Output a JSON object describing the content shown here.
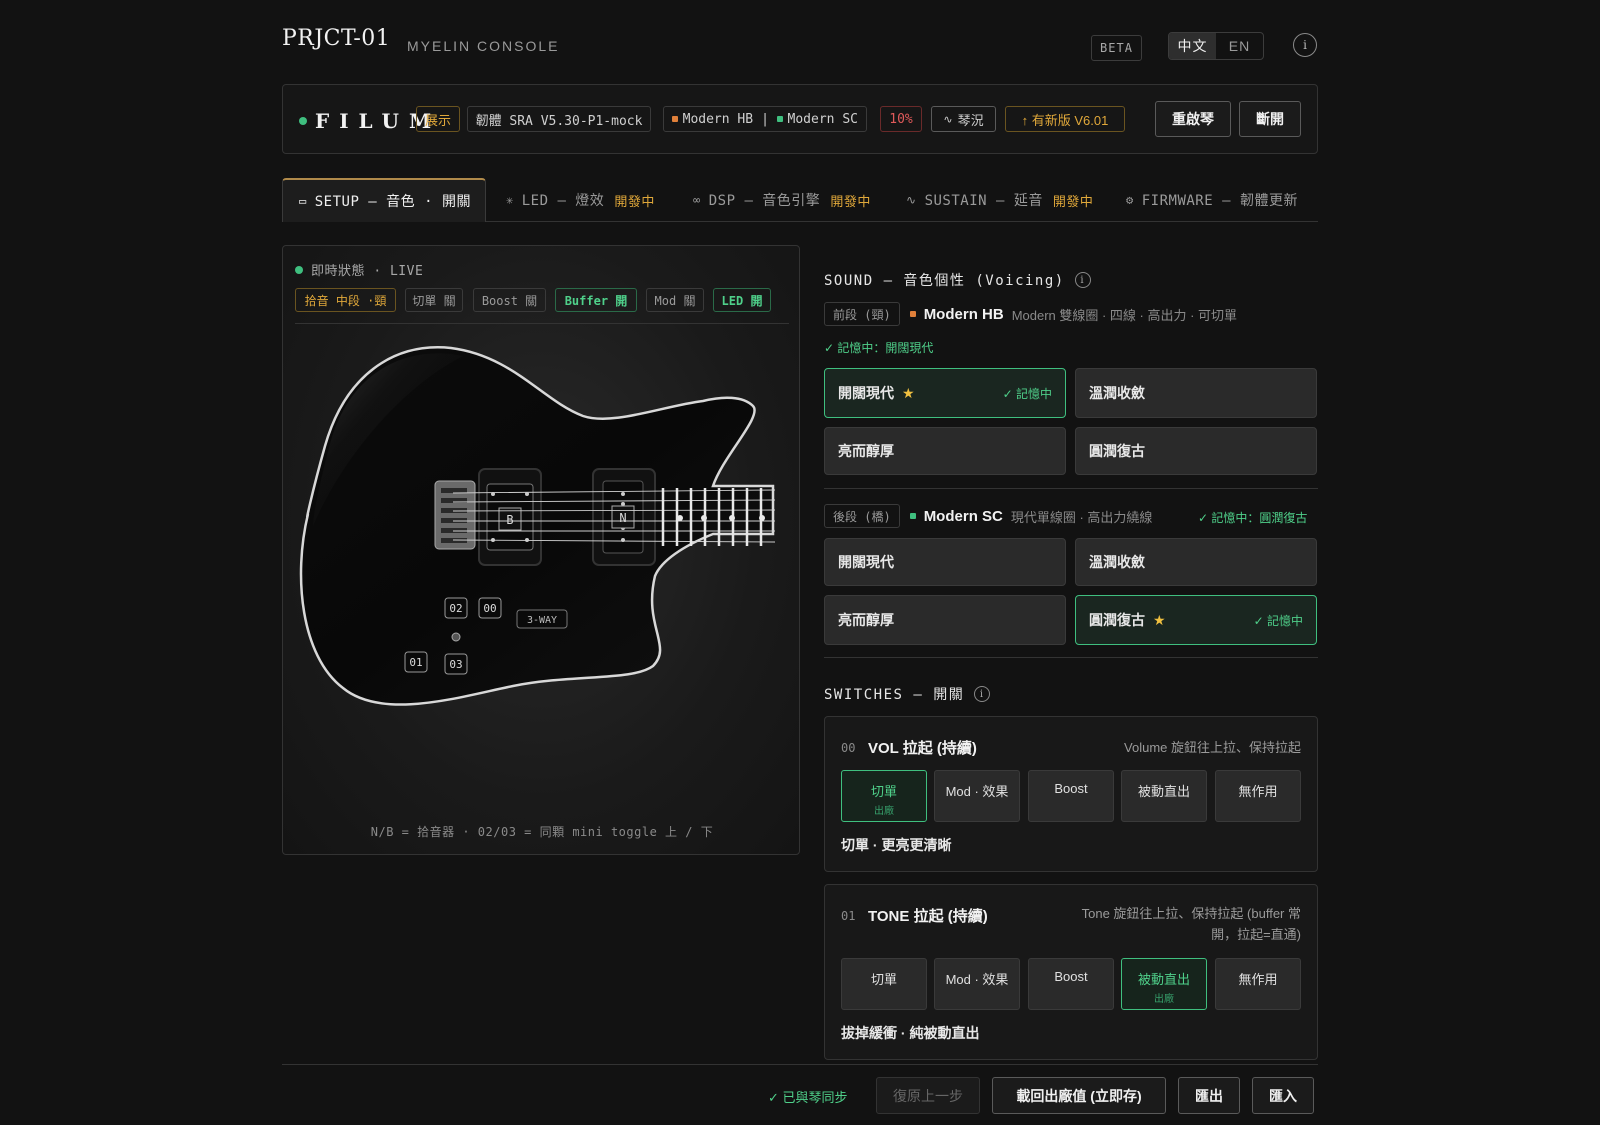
{
  "header": {
    "brand": "PRJCT-01",
    "subtitle": "MYELIN CONSOLE",
    "beta": "BETA",
    "lang_zh": "中文",
    "lang_en": "EN",
    "info": "i"
  },
  "device": {
    "name": "FILUM",
    "mode": "展示",
    "firmware": "韌體 SRA V5.30-P1-mock",
    "pickup_front": "Modern HB",
    "pickup_sep": "|",
    "pickup_back": "Modern SC",
    "battery": "10%",
    "status": "琴況",
    "update": "↑ 有新版 V6.01",
    "restart": "重啟琴",
    "disconnect": "斷開",
    "colors": {
      "hb": "#e0803a",
      "sc": "#3fbf7f"
    }
  },
  "tabs": [
    {
      "icon": "▭",
      "label": "SETUP — 音色 · 開關",
      "dev": ""
    },
    {
      "icon": "✳",
      "label": "LED — 燈效",
      "dev": "開發中"
    },
    {
      "icon": "∞",
      "label": "DSP — 音色引擎",
      "dev": "開發中"
    },
    {
      "icon": "∿",
      "label": "SUSTAIN — 延音",
      "dev": "開發中"
    },
    {
      "icon": "⚙",
      "label": "FIRMWARE — 韌體更新",
      "dev": ""
    }
  ],
  "live": {
    "label": "即時狀態 · LIVE",
    "pills": [
      "拾音 中段 ·頸",
      "切單 關",
      "Boost 關",
      "Buffer 開",
      "Mod 關",
      "LED 開"
    ],
    "guitar": {
      "bridge": "B",
      "neck": "N",
      "k02": "02",
      "k00": "00",
      "k01": "01",
      "k03": "03",
      "way": "3-WAY"
    },
    "caption": "N/B = 拾音器 · 02/03 = 同顆 mini toggle 上 / 下"
  },
  "sound": {
    "title": "SOUND — 音色個性 (Voicing)",
    "front": {
      "pos": "前段 (頸)",
      "name": "Modern HB",
      "desc": "Modern 雙線圈 · 四線 · 高出力 · 可切單",
      "memory": "✓ 記憶中：開闊現代",
      "options": [
        "開闊現代",
        "溫潤收斂",
        "亮而醇厚",
        "圓潤復古"
      ],
      "selected_check": "✓ 記憶中"
    },
    "back": {
      "pos": "後段 (橋)",
      "name": "Modern SC",
      "desc": "現代單線圈 · 高出力繞線",
      "memory": "✓ 記憶中：圓潤復古",
      "options": [
        "開闊現代",
        "溫潤收斂",
        "亮而醇厚",
        "圓潤復古"
      ],
      "selected_check": "✓ 記憶中"
    }
  },
  "switches": {
    "title": "SWITCHES — 開關",
    "vol": {
      "num": "00",
      "title": "VOL 拉起 (持續)",
      "desc": "Volume 旋鈕往上拉、保持拉起",
      "options": [
        "切單",
        "Mod · 效果",
        "Boost",
        "被動直出",
        "無作用"
      ],
      "factory": "出廠",
      "foot": "切單 · 更亮更清晰"
    },
    "tone": {
      "num": "01",
      "title": "TONE 拉起 (持續)",
      "desc1": "Tone 旋鈕往上拉、保持拉起 (buffer 常",
      "desc2": "開，拉起=直通)",
      "options": [
        "切單",
        "Mod · 效果",
        "Boost",
        "被動直出",
        "無作用"
      ],
      "factory": "出廠",
      "foot": "拔掉緩衝 · 純被動直出"
    }
  },
  "footer": {
    "synced": "✓ 已與琴同步",
    "undo": "復原上一步",
    "reset": "載回出廠值 (立即存)",
    "export": "匯出",
    "import": "匯入"
  }
}
